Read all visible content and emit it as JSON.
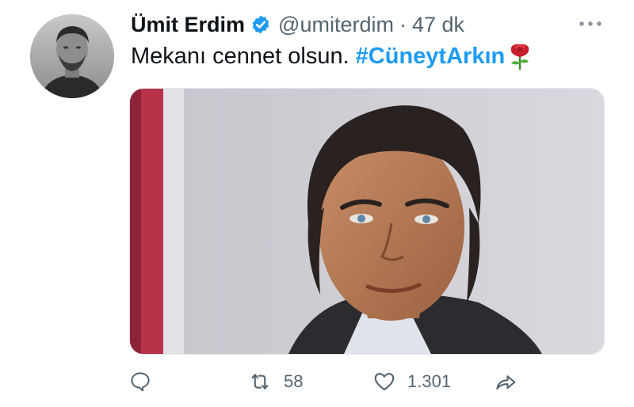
{
  "tweet": {
    "author_name": "Ümit Erdim",
    "handle": "@umiterdim",
    "separator": "·",
    "time": "47 dk",
    "text": "Mekanı cennet olsun.",
    "hashtag": "#CüneytArkın",
    "emoji": "rose-emoji"
  },
  "actions": {
    "retweets": "58",
    "likes": "1.301"
  },
  "colors": {
    "accent": "#1d9bf0",
    "muted": "#536471",
    "text": "#0f1419"
  },
  "icons": [
    "verified-badge-icon",
    "more-options-icon",
    "reply-icon",
    "retweet-icon",
    "like-icon",
    "share-icon"
  ]
}
